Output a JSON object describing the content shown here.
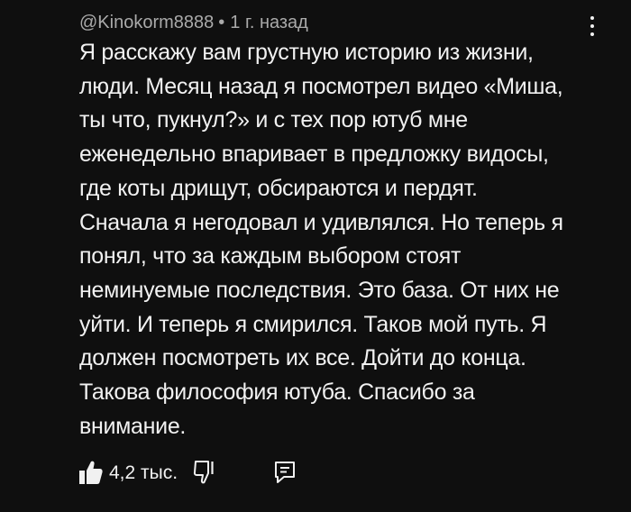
{
  "comment": {
    "author": "@Kinokorm8888",
    "separator": "•",
    "time": "1 г. назад",
    "text_lines": [
      "Я расскажу вам грустную историю из жизни,",
      "люди. Месяц назад я посмотрел видео «Миша,",
      "ты что, пукнул?» и с тех пор ютуб мне",
      "еженедельно впаривает в предложку видосы,",
      "где коты дрищут, обсираются и пердят.",
      "Сначала я негодовал и удивлялся. Но теперь я",
      "понял, что за каждым выбором стоят",
      "неминуемые последствия. Это база. От них не",
      "уйти. И теперь я смирился. Таков мой путь. Я",
      "должен посмотреть их все. Дойти до конца.",
      "Такова философия ютуба. Спасибо за",
      "внимание."
    ],
    "likes": "4,2 тыс.",
    "icons": {
      "like": "thumbs-up-filled-icon",
      "dislike": "thumbs-down-outline-icon",
      "reply": "reply-comment-icon",
      "menu": "more-vertical-icon"
    },
    "colors": {
      "background": "#0f0f0f",
      "text": "#f1f1f1",
      "meta": "#aaaaaa"
    }
  }
}
